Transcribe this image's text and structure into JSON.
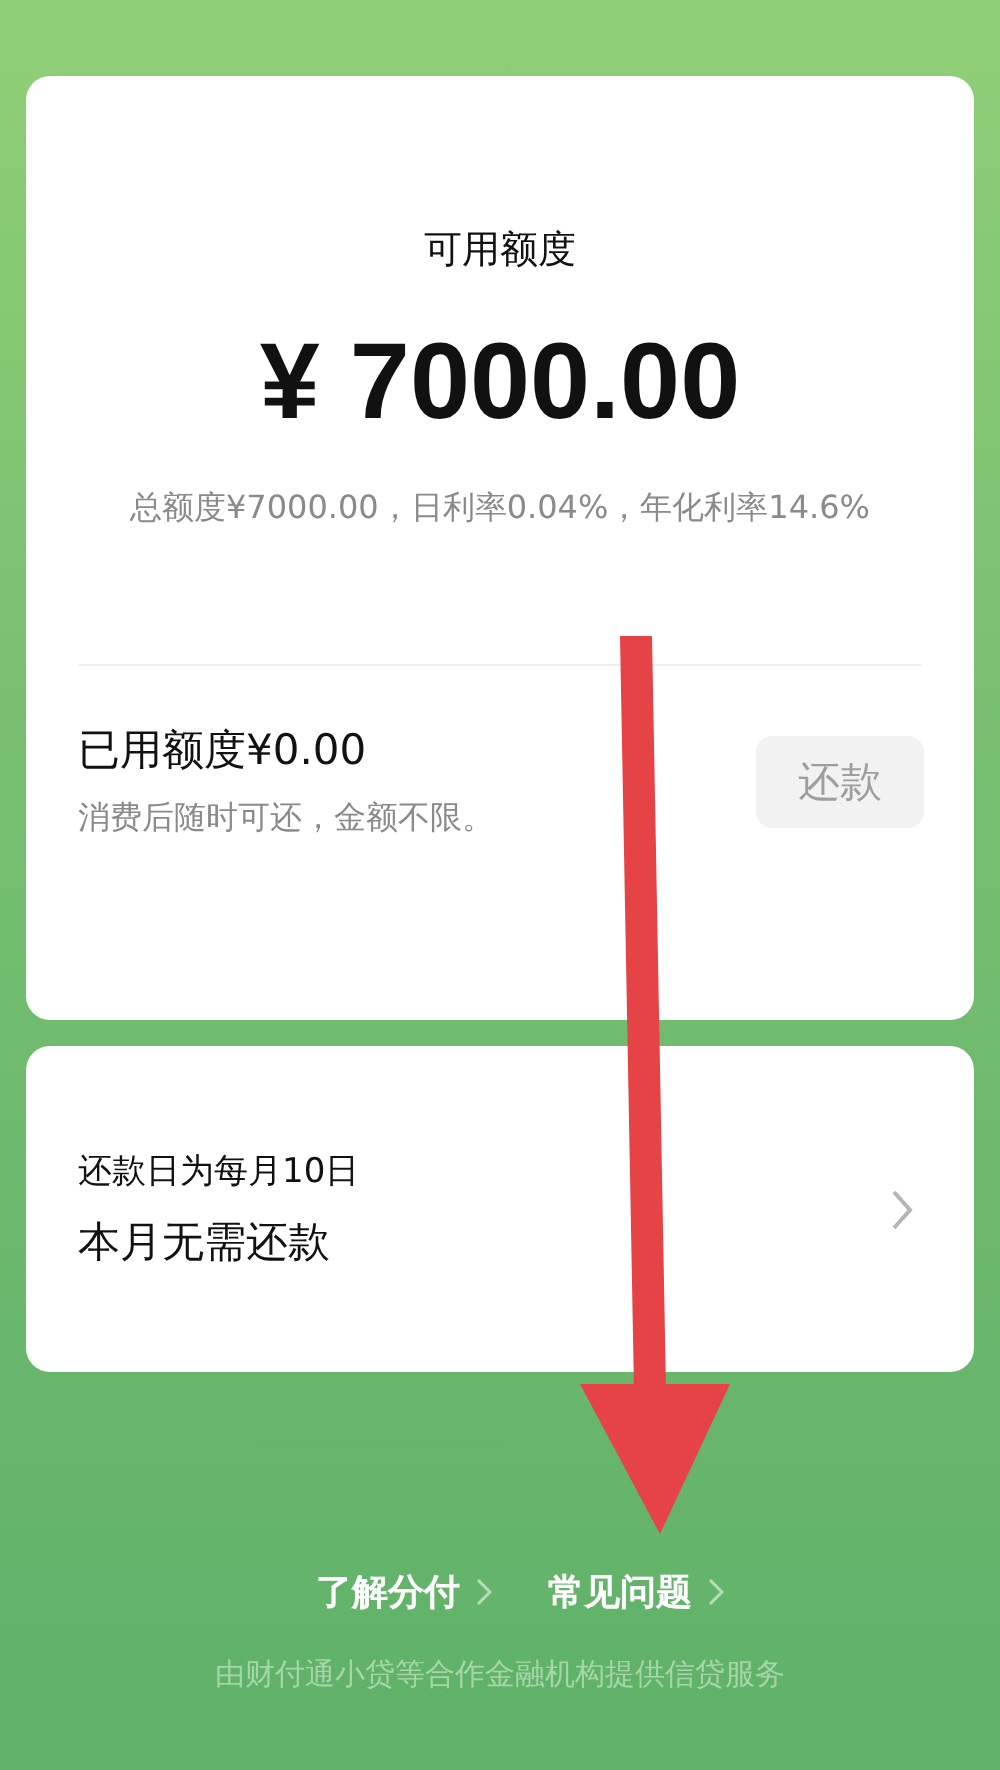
{
  "credit_card": {
    "title": "可用额度",
    "amount": "¥ 7000.00",
    "terms": "总额度¥7000.00，日利率0.04%，年化利率14.6%",
    "used": "已用额度¥0.00",
    "used_note": "消费后随时可还，金额不限。",
    "repay_button": {
      "label": "还款",
      "disabled": true
    }
  },
  "repay_card": {
    "due": "还款日为每月10日",
    "status": "本月无需还款"
  },
  "links": [
    {
      "label": "了解分付"
    },
    {
      "label": "常见问题"
    }
  ],
  "footer": "由财付通小贷等合作金融机构提供信贷服务"
}
